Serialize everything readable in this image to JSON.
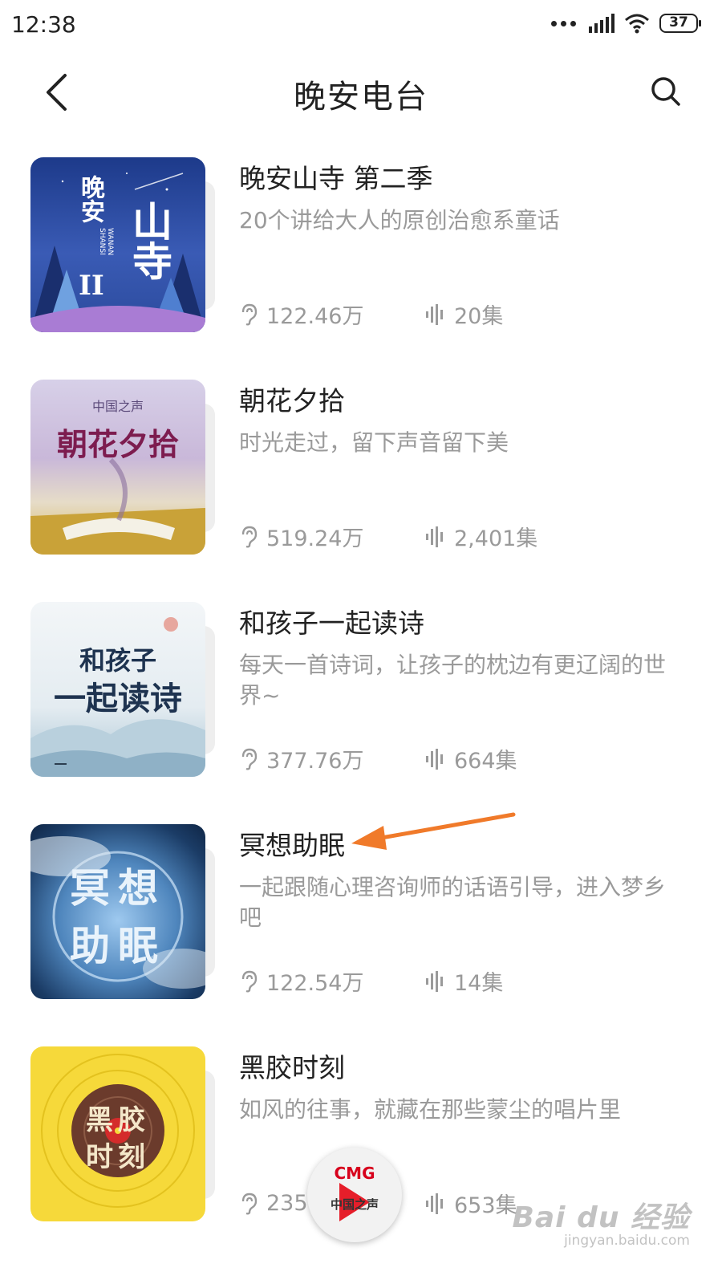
{
  "status_bar": {
    "time": "12:38",
    "battery": "37"
  },
  "header": {
    "title": "晚安电台"
  },
  "items": [
    {
      "title": "晚安山寺 第二季",
      "desc": "20个讲给大人的原创治愈系童话",
      "plays": "122.46万",
      "episodes": "20集",
      "cover_text": [
        "晚安",
        "山寺",
        "II",
        "WANAN SHANSI"
      ]
    },
    {
      "title": "朝花夕拾",
      "desc": "时光走过，留下声音留下美",
      "plays": "519.24万",
      "episodes": "2,401集",
      "cover_text": [
        "中国之声",
        "朝花夕拾"
      ]
    },
    {
      "title": "和孩子一起读诗",
      "desc": "每天一首诗词，让孩子的枕边有更辽阔的世界~",
      "plays": "377.76万",
      "episodes": "664集",
      "cover_text": [
        "和孩子",
        "一起读诗"
      ]
    },
    {
      "title": "冥想助眠",
      "desc": "一起跟随心理咨询师的话语引导，进入梦乡吧",
      "plays": "122.54万",
      "episodes": "14集",
      "cover_text": [
        "冥想",
        "助眠"
      ]
    },
    {
      "title": "黑胶时刻",
      "desc": "如风的往事，就藏在那些蒙尘的唱片里",
      "plays": "235",
      "episodes": "653集",
      "cover_text": [
        "黑胶",
        "时刻"
      ]
    }
  ],
  "mini_player": {
    "logo": "CMG",
    "subtitle": "中国之声"
  },
  "watermark": {
    "main": "Bai du 经验",
    "url": "jingyan.baidu.com"
  },
  "colors": {
    "accent_arrow": "#f07a2a",
    "meta_gray": "#9a9a9a",
    "cmg_red": "#d7001c"
  }
}
